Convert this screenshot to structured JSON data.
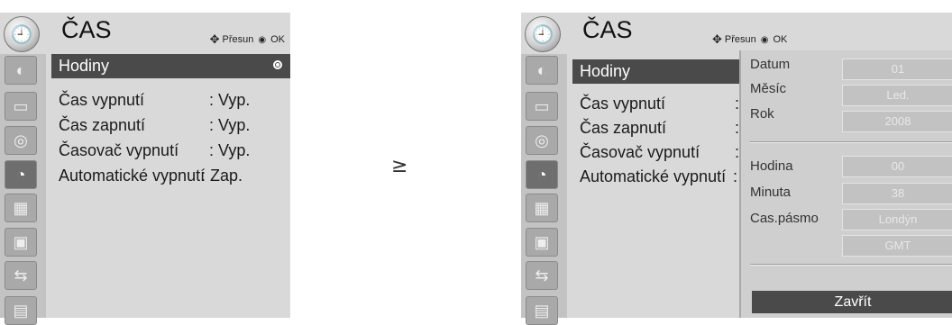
{
  "left": {
    "title": "ČAS",
    "hint_move": "Přesun",
    "hint_ok": "OK",
    "items": [
      {
        "label": "Hodiny",
        "value": ""
      },
      {
        "label": "Čas vypnutí",
        "value": ": Vyp."
      },
      {
        "label": "Čas zapnutí",
        "value": ": Vyp."
      },
      {
        "label": "Časovač vypnutí",
        "value": ": Vyp."
      },
      {
        "label": "Automatické vypnutí",
        "value": ": Zap."
      }
    ]
  },
  "arrow": "≥",
  "right": {
    "title": "ČAS",
    "hint_move": "Přesun",
    "hint_ok": "OK",
    "items": [
      {
        "label": "Hodiny"
      },
      {
        "label": "Čas vypnutí",
        "colon": ":"
      },
      {
        "label": "Čas zapnutí",
        "colon": ":"
      },
      {
        "label": "Časovač vypnutí",
        "colon": ":"
      },
      {
        "label": "Automatické vypnutí",
        "colon": ":"
      }
    ],
    "submenu": {
      "fields": [
        {
          "label": "Datum",
          "value": "01"
        },
        {
          "label": "Měsíc",
          "value": "Led."
        },
        {
          "label": "Rok",
          "value": "2008"
        },
        {
          "label": "Hodina",
          "value": "00"
        },
        {
          "label": "Minuta",
          "value": "38"
        },
        {
          "label": "Cas.pásmo",
          "value": "Londýn"
        },
        {
          "label": "",
          "value": "GMT"
        }
      ],
      "close_label": "Zavřít"
    }
  },
  "icons": [
    "picture-icon",
    "screen-icon",
    "audio-icon",
    "time-icon",
    "option-icon",
    "lock-icon",
    "input-icon",
    "usb-icon"
  ]
}
